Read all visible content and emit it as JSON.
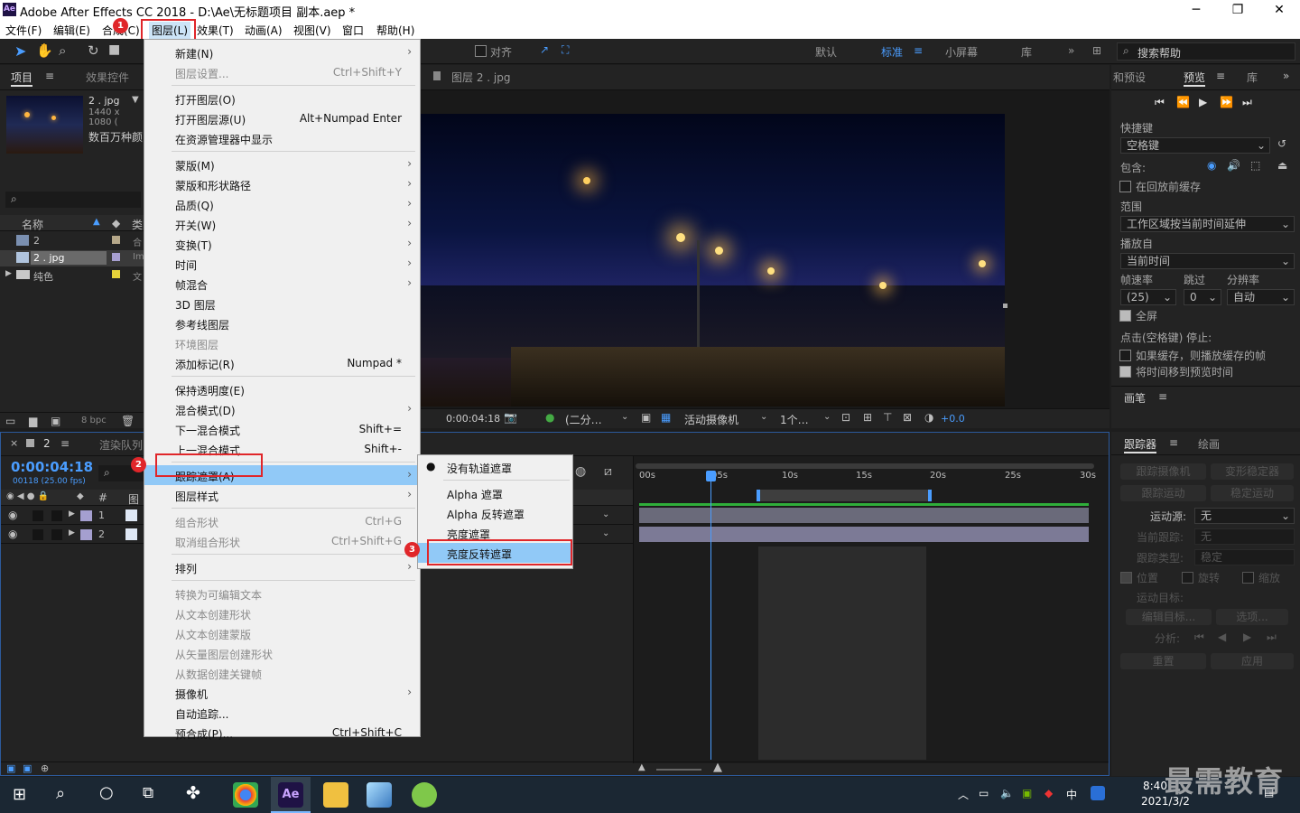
{
  "app": {
    "title": "Adobe After Effects CC 2018 - D:\\Ae\\无标题项目 副本.aep *",
    "logo": "Ae"
  },
  "window_controls": {
    "minimize": "─",
    "maximize": "❐",
    "close": "✕"
  },
  "menubar": [
    "文件(F)",
    "编辑(E)",
    "合成(C)",
    "图层(L)",
    "效果(T)",
    "动画(A)",
    "视图(V)",
    "窗口",
    "帮助(H)"
  ],
  "toolbar": {
    "snap_label": "对齐",
    "workspaces": [
      "默认",
      "标准",
      "小屏幕",
      "库"
    ],
    "active_workspace": "标准",
    "search_placeholder": "搜索帮助"
  },
  "project_panel": {
    "tab": "项目",
    "effects_tab": "效果控件",
    "item_name": "2 . jpg",
    "item_dims": "1440 x 1080 (",
    "item_note": "数百万种颜",
    "col_name": "名称",
    "col_type": "类",
    "rows": [
      {
        "name": "2",
        "type": "合"
      },
      {
        "name": "2 . jpg",
        "type": "Im"
      },
      {
        "name": "纯色",
        "type": "文"
      }
    ],
    "bpc": "8 bpc"
  },
  "comp_viewer": {
    "tab": "图层 2 . jpg",
    "timecode": "0:00:04:18",
    "resolution": "(二分…",
    "camera": "活动摄像机",
    "views": "1个…",
    "exposure": "+0.0"
  },
  "layer_menu": {
    "items": [
      {
        "label": "新建(N)",
        "shortcut": "",
        "arrow": true,
        "disabled": false
      },
      {
        "label": "图层设置...",
        "shortcut": "Ctrl+Shift+Y",
        "arrow": false,
        "disabled": true
      },
      {
        "label": "打开图层(O)",
        "shortcut": "",
        "arrow": false,
        "disabled": false
      },
      {
        "label": "打开图层源(U)",
        "shortcut": "Alt+Numpad Enter",
        "arrow": false,
        "disabled": false
      },
      {
        "label": "在资源管理器中显示",
        "shortcut": "",
        "arrow": false,
        "disabled": false
      },
      {
        "label": "蒙版(M)",
        "shortcut": "",
        "arrow": true,
        "disabled": false
      },
      {
        "label": "蒙版和形状路径",
        "shortcut": "",
        "arrow": true,
        "disabled": false
      },
      {
        "label": "品质(Q)",
        "shortcut": "",
        "arrow": true,
        "disabled": false
      },
      {
        "label": "开关(W)",
        "shortcut": "",
        "arrow": true,
        "disabled": false
      },
      {
        "label": "变换(T)",
        "shortcut": "",
        "arrow": true,
        "disabled": false
      },
      {
        "label": "时间",
        "shortcut": "",
        "arrow": true,
        "disabled": false
      },
      {
        "label": "帧混合",
        "shortcut": "",
        "arrow": true,
        "disabled": false
      },
      {
        "label": "3D 图层",
        "shortcut": "",
        "arrow": false,
        "disabled": false
      },
      {
        "label": "参考线图层",
        "shortcut": "",
        "arrow": false,
        "disabled": false
      },
      {
        "label": "环境图层",
        "shortcut": "",
        "arrow": false,
        "disabled": true
      },
      {
        "label": "添加标记(R)",
        "shortcut": "Numpad *",
        "arrow": false,
        "disabled": false
      },
      {
        "label": "保持透明度(E)",
        "shortcut": "",
        "arrow": false,
        "disabled": false
      },
      {
        "label": "混合模式(D)",
        "shortcut": "",
        "arrow": true,
        "disabled": false
      },
      {
        "label": "下一混合模式",
        "shortcut": "Shift+=",
        "arrow": false,
        "disabled": false
      },
      {
        "label": "上一混合模式",
        "shortcut": "Shift+-",
        "arrow": false,
        "disabled": false
      },
      {
        "label": "跟踪遮罩(A)",
        "shortcut": "",
        "arrow": true,
        "disabled": false,
        "highlighted": true
      },
      {
        "label": "图层样式",
        "shortcut": "",
        "arrow": true,
        "disabled": false
      },
      {
        "label": "组合形状",
        "shortcut": "Ctrl+G",
        "arrow": false,
        "disabled": true
      },
      {
        "label": "取消组合形状",
        "shortcut": "Ctrl+Shift+G",
        "arrow": false,
        "disabled": true
      },
      {
        "label": "排列",
        "shortcut": "",
        "arrow": true,
        "disabled": false
      },
      {
        "label": "转换为可编辑文本",
        "shortcut": "",
        "arrow": false,
        "disabled": true
      },
      {
        "label": "从文本创建形状",
        "shortcut": "",
        "arrow": false,
        "disabled": true
      },
      {
        "label": "从文本创建蒙版",
        "shortcut": "",
        "arrow": false,
        "disabled": true
      },
      {
        "label": "从矢量图层创建形状",
        "shortcut": "",
        "arrow": false,
        "disabled": true
      },
      {
        "label": "从数据创建关键帧",
        "shortcut": "",
        "arrow": false,
        "disabled": true
      },
      {
        "label": "摄像机",
        "shortcut": "",
        "arrow": true,
        "disabled": false
      },
      {
        "label": "自动追踪...",
        "shortcut": "",
        "arrow": false,
        "disabled": false
      },
      {
        "label": "预合成(P)...",
        "shortcut": "Ctrl+Shift+C",
        "arrow": false,
        "disabled": false
      }
    ]
  },
  "track_matte_submenu": {
    "items": [
      "没有轨道遮罩",
      "Alpha 遮罩",
      "Alpha 反转遮罩",
      "亮度遮罩",
      "亮度反转遮罩"
    ],
    "checked": "没有轨道遮罩",
    "highlighted": "亮度反转遮罩"
  },
  "callouts": [
    "1",
    "2",
    "3"
  ],
  "timeline": {
    "tab": "2",
    "render_tab": "渲染队列",
    "timecode": "0:00:04:18",
    "frame_info": "00118 (25.00 fps)",
    "col_hash": "#",
    "col_src": "图",
    "layers": [
      {
        "num": "1"
      },
      {
        "num": "2"
      }
    ],
    "ruler": [
      "00s",
      "05s",
      "10s",
      "15s",
      "20s",
      "25s",
      "30s"
    ]
  },
  "preview_panel": {
    "tab_presets": "和预设",
    "tab_preview": "预览",
    "tab_lib": "库",
    "shortcut_label": "快捷键",
    "shortcut_value": "空格键",
    "include_label": "包含:",
    "cache_before": "在回放前缓存",
    "range_label": "范围",
    "range_value": "工作区域按当前时间延伸",
    "play_from_label": "播放自",
    "play_from_value": "当前时间",
    "fps_label": "帧速率",
    "skip_label": "跳过",
    "res_label": "分辨率",
    "fps_value": "(25)",
    "skip_value": "0",
    "res_value": "自动",
    "fullscreen": "全屏",
    "stop_label": "点击(空格键) 停止:",
    "if_cached": "如果缓存，则播放缓存的帧",
    "move_time": "将时间移到预览时间"
  },
  "brush_panel": {
    "tab": "画笔"
  },
  "tracker_panel": {
    "tab": "跟踪器",
    "tab2": "绘画",
    "track_camera": "跟踪摄像机",
    "warp_stab": "变形稳定器",
    "track_motion": "跟踪运动",
    "stabilize": "稳定运动",
    "motion_source": "运动源:",
    "motion_source_value": "无",
    "current_track": "当前跟踪:",
    "current_track_value": "无",
    "track_type": "跟踪类型:",
    "track_type_value": "稳定",
    "position": "位置",
    "rotation": "旋转",
    "scale": "缩放",
    "motion_target": "运动目标:",
    "edit_target": "编辑目标...",
    "options": "选项...",
    "analyze": "分析:",
    "reset": "重置",
    "apply": "应用"
  },
  "taskbar": {
    "time": "8:40",
    "date": "2021/3/2",
    "ime": "中"
  },
  "watermark": "最需教育"
}
